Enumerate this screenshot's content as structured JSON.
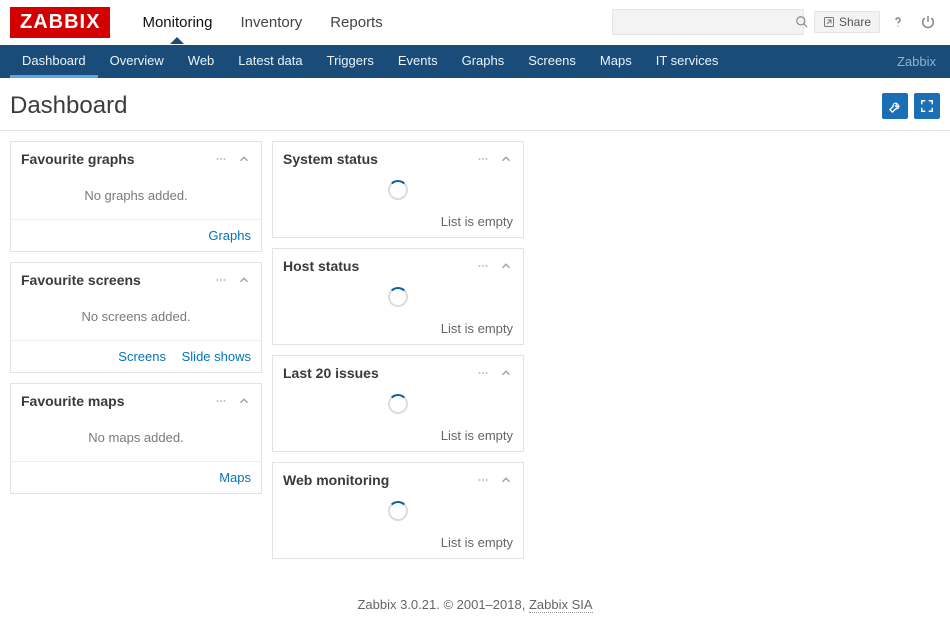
{
  "logo": "ZABBIX",
  "mainnav": {
    "items": [
      "Monitoring",
      "Inventory",
      "Reports"
    ],
    "active": 0
  },
  "search": {
    "placeholder": ""
  },
  "share": "Share",
  "subnav": {
    "items": [
      "Dashboard",
      "Overview",
      "Web",
      "Latest data",
      "Triggers",
      "Events",
      "Graphs",
      "Screens",
      "Maps",
      "IT services"
    ],
    "active": 0,
    "right": "Zabbix"
  },
  "page_title": "Dashboard",
  "col1": [
    {
      "title": "Favourite graphs",
      "empty": "No graphs added.",
      "links": [
        "Graphs"
      ]
    },
    {
      "title": "Favourite screens",
      "empty": "No screens added.",
      "links": [
        "Screens",
        "Slide shows"
      ]
    },
    {
      "title": "Favourite maps",
      "empty": "No maps added.",
      "links": [
        "Maps"
      ]
    }
  ],
  "col2": [
    {
      "title": "System status",
      "status": "List is empty"
    },
    {
      "title": "Host status",
      "status": "List is empty"
    },
    {
      "title": "Last 20 issues",
      "status": "List is empty"
    },
    {
      "title": "Web monitoring",
      "status": "List is empty"
    }
  ],
  "footer": {
    "prefix": "Zabbix 3.0.21. © 2001–2018, ",
    "link": "Zabbix SIA"
  }
}
